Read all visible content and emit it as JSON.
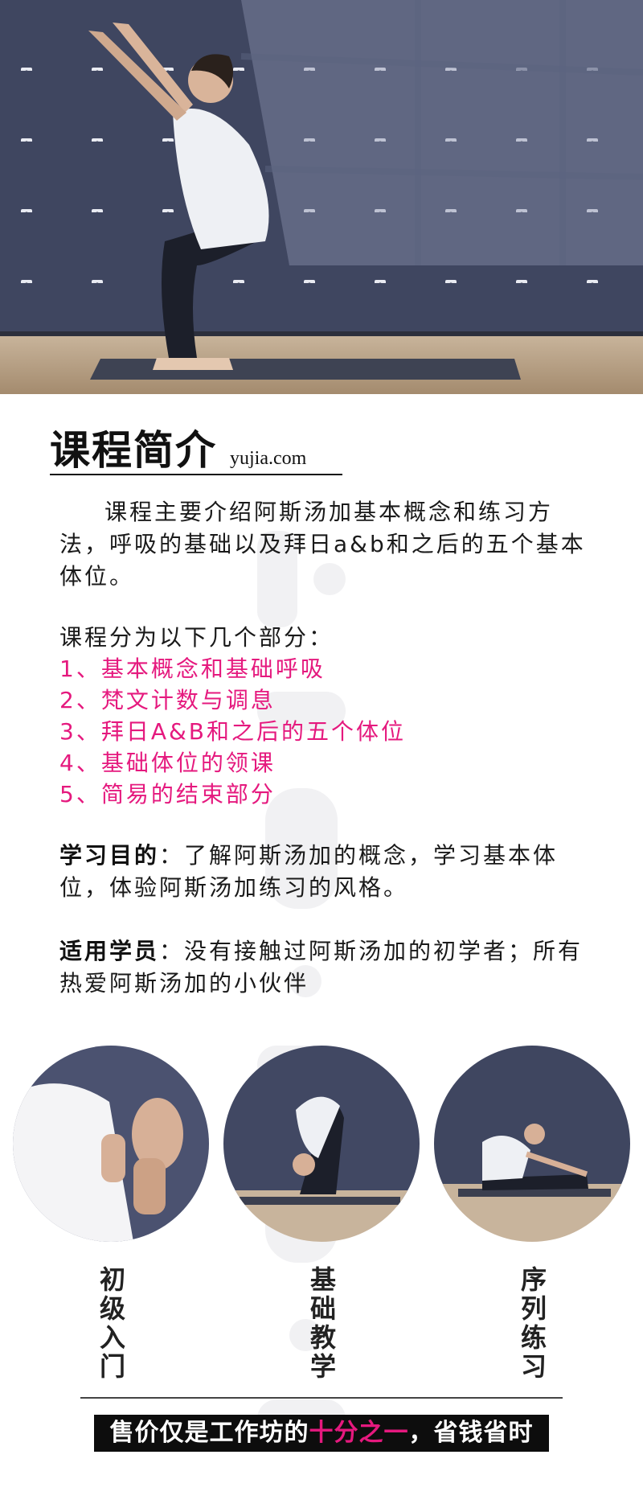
{
  "hero": {
    "image": "man-yoga-chair-pose-photo"
  },
  "intro": {
    "title": "课程简介",
    "site": "yujia.com",
    "paragraph": "课程主要介绍阿斯汤加基本概念和练习方法，呼吸的基础以及拜日a&b和之后的五个基本体位。"
  },
  "parts": {
    "heading": "课程分为以下几个部分：",
    "items": [
      "1、基本概念和基础呼吸",
      "2、梵文计数与调息",
      "3、拜日A&B和之后的五个体位",
      "4、基础体位的领课",
      "5、简易的结束部分"
    ]
  },
  "goal": {
    "label": "学习目的",
    "text": "：了解阿斯汤加的概念，学习基本体位，体验阿斯汤加练习的风格。"
  },
  "target": {
    "label": "适用学员",
    "text": "：没有接触过阿斯汤加的初学者；所有热爱阿斯汤加的小伙伴"
  },
  "features": [
    {
      "image": "hands-mudra-photo",
      "label": "初级入门"
    },
    {
      "image": "forward-fold-photo",
      "label": "基础教学"
    },
    {
      "image": "seated-forward-bend-photo",
      "label": "序列练习"
    }
  ],
  "banner": {
    "before": "售价仅是工作坊的",
    "highlight": "十分之一",
    "after": "，省钱省时"
  },
  "colors": {
    "accent": "#e5197e",
    "banner_bg": "#0d0d0d",
    "wall": "#3f4660"
  }
}
